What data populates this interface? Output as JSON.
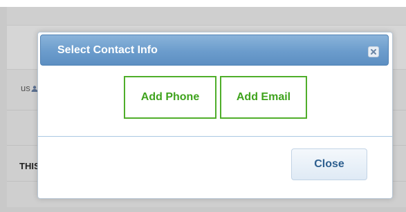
{
  "background": {
    "row1_text": "us",
    "row3_text": "THIS",
    "user_icon": "user-icon"
  },
  "modal": {
    "title": "Select Contact Info",
    "close_icon": "close-icon",
    "add_phone_label": "Add Phone",
    "add_email_label": "Add Email",
    "close_label": "Close"
  },
  "colors": {
    "header_blue": "#6b9ccc",
    "action_green": "#3fa31d",
    "overlay_gray": "#c9c9c9"
  }
}
